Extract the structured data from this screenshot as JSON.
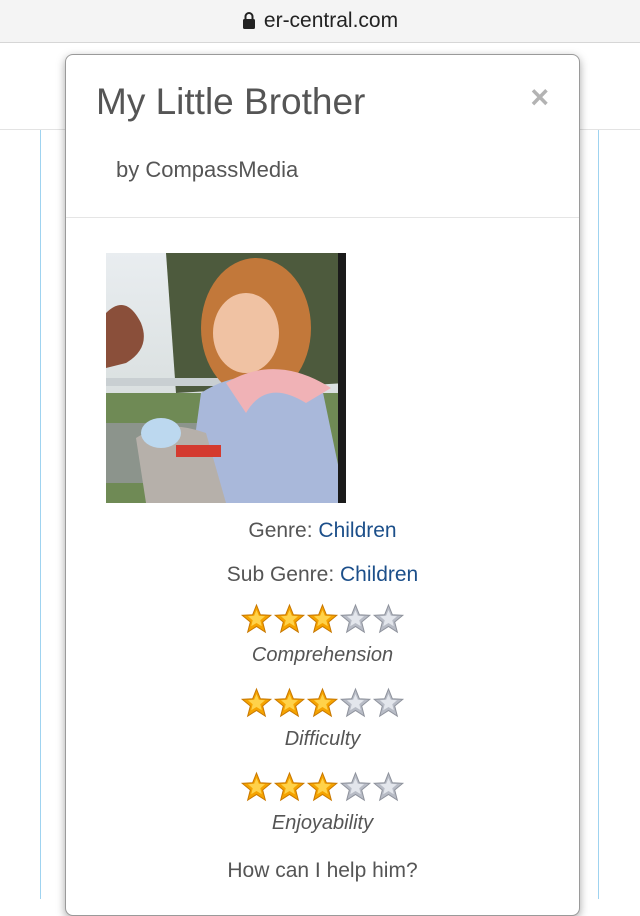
{
  "browser": {
    "url": "er-central.com"
  },
  "modal": {
    "title": "My Little Brother",
    "author": "by CompassMedia",
    "close_label": "×"
  },
  "book": {
    "genre_label": "Genre:",
    "genre_value": "Children",
    "subgenre_label": "Sub Genre:",
    "subgenre_value": "Children"
  },
  "ratings": [
    {
      "label": "Comprehension",
      "stars": 3,
      "max": 5
    },
    {
      "label": "Difficulty",
      "stars": 3,
      "max": 5
    },
    {
      "label": "Enjoyability",
      "stars": 3,
      "max": 5
    }
  ],
  "question": "How can I help him?",
  "colors": {
    "link": "#1c4f8a",
    "star_filled": "#f5a300",
    "star_empty": "#b8bcc6"
  }
}
